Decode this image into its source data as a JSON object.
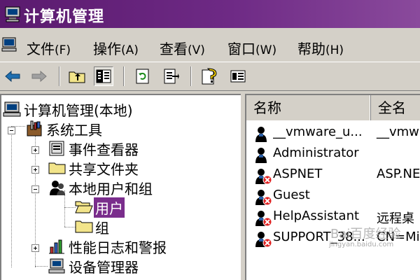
{
  "window": {
    "title": "计算机管理"
  },
  "menu": [
    {
      "label": "文件",
      "key": "(F)"
    },
    {
      "label": "操作",
      "key": "(A)"
    },
    {
      "label": "查看",
      "key": "(V)"
    },
    {
      "label": "窗口",
      "key": "(W)"
    },
    {
      "label": "帮助",
      "key": "(H)"
    }
  ],
  "toolbar": {
    "buttons": [
      "back-arrow-icon",
      "forward-arrow-icon",
      "up-folder-icon",
      "show-hide-tree-icon",
      "refresh-icon",
      "export-list-icon",
      "help-icon",
      "properties-icon"
    ]
  },
  "tree": {
    "root": "计算机管理(本地)",
    "system_tools": "系统工具",
    "event_viewer": "事件查看器",
    "shared_folders": "共享文件夹",
    "local_users_groups": "本地用户和组",
    "users": "用户",
    "groups": "组",
    "perf_logs": "性能日志和警报",
    "device_manager": "设备管理器"
  },
  "list": {
    "columns": [
      "名称",
      "全名"
    ],
    "rows": [
      {
        "name": "__vmware_u...",
        "full": "__vmwa",
        "disabled": false
      },
      {
        "name": "Administrator",
        "full": "",
        "disabled": false
      },
      {
        "name": "ASPNET",
        "full": "ASP.NE",
        "disabled": true
      },
      {
        "name": "Guest",
        "full": "",
        "disabled": true
      },
      {
        "name": "HelpAssistant",
        "full": "远程桌",
        "disabled": true
      },
      {
        "name": "SUPPORT_38...",
        "full": "CN=Mic",
        "disabled": true
      }
    ]
  },
  "watermark": {
    "text": "Bai百度经验",
    "sub": "jingyan.baidu.com"
  }
}
